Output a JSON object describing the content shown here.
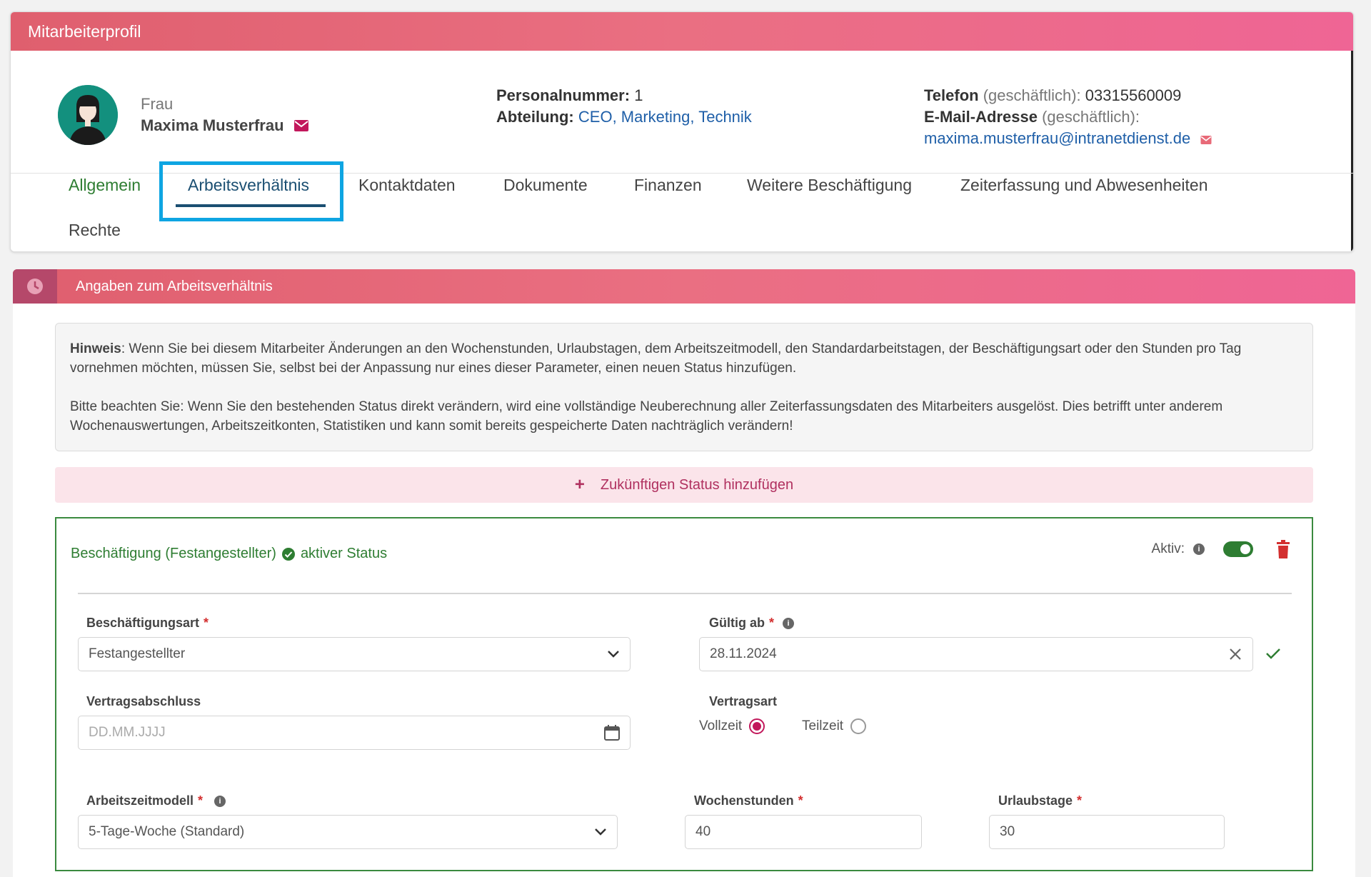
{
  "profile": {
    "header_title": "Mitarbeiterprofil",
    "salutation": "Frau",
    "name": "Maxima Musterfrau",
    "personalnummer_label": "Personalnummer:",
    "personalnummer_value": "1",
    "abteilung_label": "Abteilung:",
    "abteilung_value": "CEO, Marketing, Technik",
    "telefon_label": "Telefon",
    "telefon_qualifier": "(geschäftlich):",
    "telefon_value": "03315560009",
    "email_label": "E-Mail-Adresse",
    "email_qualifier": "(geschäftlich):",
    "email_value": "maxima.musterfrau@intranetdienst.de"
  },
  "tabs": [
    {
      "label": "Allgemein"
    },
    {
      "label": "Arbeitsverhältnis",
      "active": true
    },
    {
      "label": "Kontaktdaten"
    },
    {
      "label": "Dokumente"
    },
    {
      "label": "Finanzen"
    },
    {
      "label": "Weitere Beschäftigung"
    },
    {
      "label": "Zeiterfassung und Abwesenheiten"
    },
    {
      "label": "Rechte"
    }
  ],
  "section": {
    "title": "Angaben zum Arbeitsverhältnis",
    "hint_label": "Hinweis",
    "hint_text": ": Wenn Sie bei diesem Mitarbeiter Änderungen an den Wochenstunden, Urlaubstagen, dem Arbeitszeitmodell, den Standardarbeitstagen, der Beschäftigungsart oder den Stunden pro Tag vornehmen möchten, müssen Sie, selbst bei der Anpassung nur eines dieser Parameter, einen neuen Status hinzufügen.",
    "hint_text2": "Bitte beachten Sie: Wenn Sie den bestehenden Status direkt verändern, wird eine vollständige Neuberechnung aller Zeiterfassungsdaten des Mitarbeiters ausgelöst. Dies betrifft unter anderem Wochenauswertungen, Arbeitszeitkonten, Statistiken und kann somit bereits gespeicherte Daten nachträglich verändern!",
    "add_status_label": "Zukünftigen Status hinzufügen"
  },
  "status": {
    "title": "Beschäftigung (Festangestellter)",
    "active_label": "aktiver Status",
    "aktiv_label": "Aktiv:",
    "colors": {
      "green": "#2e7d32",
      "accent": "#c2185b",
      "delete": "#d32f2f"
    }
  },
  "form": {
    "beschaeftigungsart_label": "Beschäftigungsart",
    "beschaeftigungsart_value": "Festangestellter",
    "gueltig_ab_label": "Gültig ab",
    "gueltig_ab_value": "28.11.2024",
    "vertragsabschluss_label": "Vertragsabschluss",
    "vertragsabschluss_placeholder": "DD.MM.JJJJ",
    "vertragsart_label": "Vertragsart",
    "vertragsart_options": [
      "Vollzeit",
      "Teilzeit"
    ],
    "vertragsart_selected": "Vollzeit",
    "arbeitszeitmodell_label": "Arbeitszeitmodell",
    "arbeitszeitmodell_value": "5-Tage-Woche (Standard)",
    "wochenstunden_label": "Wochenstunden",
    "wochenstunden_value": "40",
    "urlaubstage_label": "Urlaubstage",
    "urlaubstage_value": "30",
    "required_mark": "*"
  }
}
